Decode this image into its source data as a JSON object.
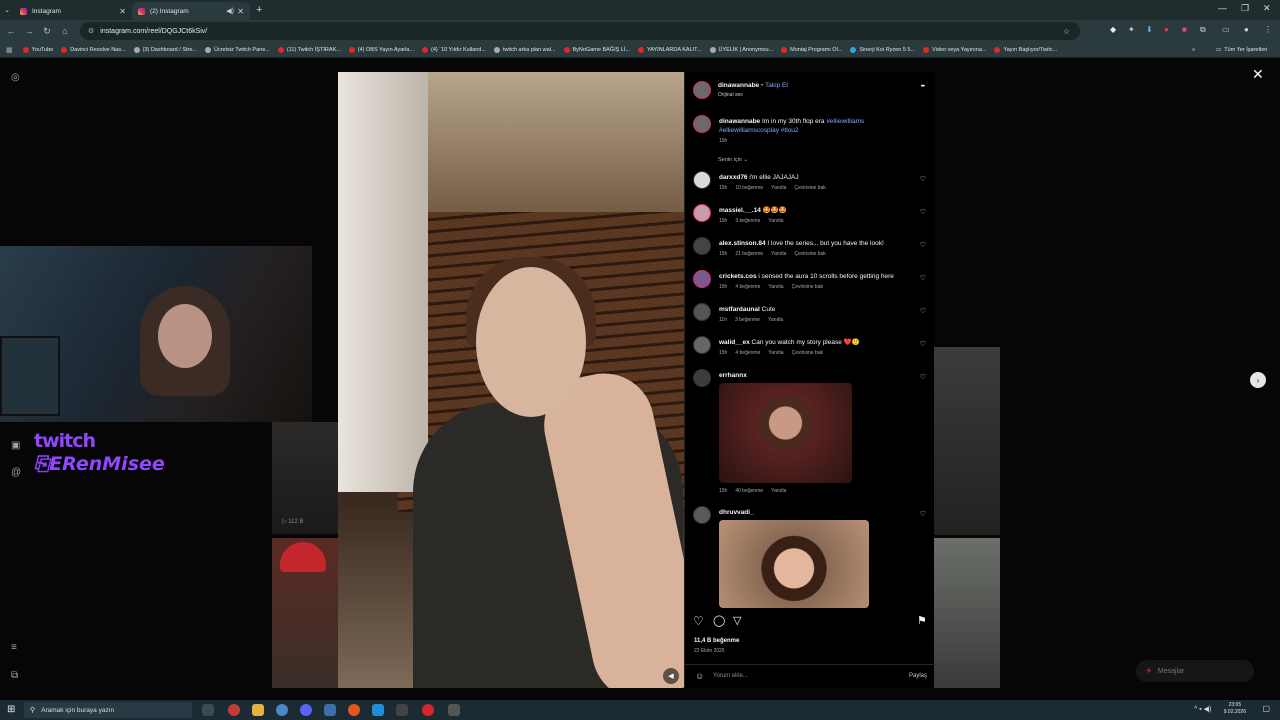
{
  "browser": {
    "tabs": [
      {
        "title": "Instagram",
        "active": false
      },
      {
        "title": "(2) Instagram",
        "active": true
      }
    ],
    "url": "instagram.com/reel/DQGJCt6kSiv/",
    "bookmarks": [
      "YouTube",
      "Davinci Resolve Nas...",
      "(3) Dashboard / Stre...",
      "Ücretsiz Twitch Pane...",
      "(11) Twitch İŞTİRAK...",
      "(4) OBS Yayın Ayarla...",
      "(4) ¨10 Yıldır Kulland...",
      "twitch arka plan wal...",
      "ByNoGame BAĞIŞ Lİ...",
      "YAYINLARDA KALIT...",
      "ÜYELİK | Anonymou...",
      "Montaj Programı Ol...",
      "Sinerji Koi Ryzen 5 5...",
      "Video veya Yayınına...",
      "Yayın Başlıyor/Twitc..."
    ],
    "other_bookmarks": "Tüm Yer İşaretleri"
  },
  "overlay": {
    "twitch_logo": "twitch",
    "twitch_name": "ERenMisee",
    "thumb_views": "112 B"
  },
  "post": {
    "author": "dinawannabe",
    "follow": "Takip Et",
    "audio": "Orijinal ses",
    "more": "•••",
    "caption": {
      "user": "dinawannabe",
      "text": "Im in my 30th flop era",
      "tags": "#elliewilliams #elliewilliamscosplay #tlou2",
      "time": "15h"
    },
    "sort_label": "Senin için",
    "comments": [
      {
        "user": "darxxd76",
        "text": "i'm ellie JAJAJAJ",
        "time": "15h",
        "likes": "10 beğenme",
        "reply": "Yanıtla",
        "translate": "Çevirisine bak"
      },
      {
        "user": "massiel.__.14",
        "text": "🤩🤩🤩",
        "time": "15h",
        "likes": "3 beğenme",
        "reply": "Yanıtla",
        "translate": ""
      },
      {
        "user": "alex.stinson.84",
        "text": "I love the series... but you have the look!",
        "time": "15h",
        "likes": "21 beğenme",
        "reply": "Yanıtla",
        "translate": "Çevirisine bak"
      },
      {
        "user": "crickets.cos",
        "text": "i sensed the aura 10 scrolls before getting here",
        "time": "15h",
        "likes": "4 beğenme",
        "reply": "Yanıtla",
        "translate": "Çevirisine bak"
      },
      {
        "user": "mstfardaunal",
        "text": "Cute",
        "time": "11h",
        "likes": "3 beğenme",
        "reply": "Yanıtla",
        "translate": ""
      },
      {
        "user": "walid__ex",
        "text": "Can you watch my story please ❤️🙂",
        "time": "15h",
        "likes": "4 beğenme",
        "reply": "Yanıtla",
        "translate": "Çevirisine bak"
      },
      {
        "user": "errhannx",
        "text": "",
        "time": "15h",
        "likes": "40 beğenme",
        "reply": "Yanıtla",
        "translate": ""
      },
      {
        "user": "dhruvvadi_",
        "text": "",
        "time": "",
        "likes": "",
        "reply": "",
        "translate": ""
      }
    ],
    "likes_total": "11,4 B beğenme",
    "date": "22 Ekim 2025",
    "comment_placeholder": "Yorum ekle...",
    "share": "Paylaş"
  },
  "messages_label": "Mesajlar",
  "taskbar": {
    "search_placeholder": "Aramak için buraya yazın",
    "time": "23:05",
    "date": "9.02.2026"
  },
  "icons": [
    "instagram-icon",
    "close-icon",
    "heart-icon",
    "comment-icon",
    "send-icon",
    "bookmark-icon",
    "emoji-icon",
    "chevron-right-icon",
    "windows-icon",
    "search-icon"
  ]
}
